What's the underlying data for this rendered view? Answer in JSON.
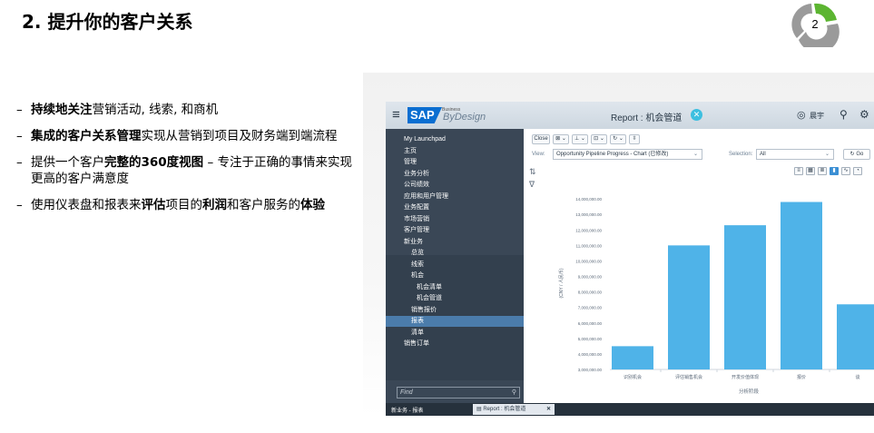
{
  "slide": {
    "title": "2. 提升你的客户关系",
    "step_number": "2",
    "bullets": [
      [
        {
          "t": "持续地关注",
          "b": true
        },
        {
          "t": "营销活动, 线索, 和商机",
          "b": false
        }
      ],
      [
        {
          "t": "集成的客户关系管理",
          "b": true
        },
        {
          "t": "实现从营销到项目及财务端到端流程",
          "b": false
        }
      ],
      [
        {
          "t": "提供一个客户",
          "b": false
        },
        {
          "t": "完整的360度视图",
          "b": true
        },
        {
          "t": " – 专注于正确的事情来实现更高的客户满意度",
          "b": false
        }
      ],
      [
        {
          "t": "使用仪表盘和报表来",
          "b": false
        },
        {
          "t": "评估",
          "b": true
        },
        {
          "t": "项目的",
          "b": false
        },
        {
          "t": "利润",
          "b": true
        },
        {
          "t": "和客户服务的",
          "b": false
        },
        {
          "t": "体验",
          "b": true
        }
      ]
    ],
    "colors": {
      "badge_green": "#5cb531",
      "badge_gray": "#9a9a9a"
    }
  },
  "app": {
    "logo_text": "SAP",
    "logo_super": "Business",
    "logo_name": "ByDesign",
    "report_title": "Report : 机会管道",
    "user_name": "晨宇",
    "icons": {
      "menu": "hamburger-icon",
      "close": "close-icon",
      "user": "user-icon",
      "search": "search-icon",
      "settings": "gear-icon"
    },
    "sidebar": {
      "items": [
        {
          "label": "My Launchpad",
          "level": 1
        },
        {
          "label": "主页",
          "level": 1
        },
        {
          "label": "管理",
          "level": 1
        },
        {
          "label": "业务分析",
          "level": 1
        },
        {
          "label": "公司绩效",
          "level": 1
        },
        {
          "label": "应用和用户管理",
          "level": 1
        },
        {
          "label": "业务配置",
          "level": 1
        },
        {
          "label": "市场营销",
          "level": 1
        },
        {
          "label": "客户管理",
          "level": 1
        },
        {
          "label": "新业务",
          "level": 1
        },
        {
          "label": "总览",
          "level": 2
        },
        {
          "label": "线索",
          "level": 2
        },
        {
          "label": "机会",
          "level": 2
        },
        {
          "label": "机会清单",
          "level": 3
        },
        {
          "label": "机会管道",
          "level": 3
        },
        {
          "label": "销售报价",
          "level": 2
        },
        {
          "label": "报表",
          "level": 2,
          "active": true
        },
        {
          "label": "清单",
          "level": 2
        },
        {
          "label": "销售订单",
          "level": 1
        }
      ],
      "find_placeholder": "Find"
    },
    "toolbar": {
      "close_label": "Close",
      "btn2": "⊠ ⌄",
      "btn3": "⊥ ⌄",
      "btn4": "⊡ ⌄",
      "btn5": "↻ ⌄",
      "btn6": "⇳"
    },
    "view": {
      "label": "View:",
      "value": "Opportunity Pipeline Progress - Chart (已修改)",
      "selection_label": "Selection:",
      "selection_value": "All",
      "go_label": "Go"
    },
    "chart_data": {
      "type": "bar",
      "categories": [
        "识别机会",
        "评估销售机会",
        "开发价值体现",
        "报价",
        "谈"
      ],
      "values": [
        4500000,
        11000000,
        12300000,
        13800000,
        7200000
      ],
      "ylabel": "(CNY / 人民币)",
      "xlabel": "分析阶段",
      "ylim": [
        3000000,
        15000000
      ],
      "y_ticks": [
        "14,000,000.00",
        "13,000,000.00",
        "12,000,000.00",
        "11,000,000.00",
        "10,000,000.00",
        "9,000,000.00",
        "8,000,000.00",
        "7,000,000.00",
        "6,000,000.00",
        "5,000,000.00",
        "4,000,000.00",
        "3,000,000.00"
      ],
      "y_tick_values": [
        14000000,
        13000000,
        12000000,
        11000000,
        10000000,
        9000000,
        8000000,
        7000000,
        6000000,
        5000000,
        4000000,
        3000000
      ],
      "grid": false,
      "bar_color": "#4fb3e8"
    },
    "status": {
      "breadcrumb": "新业务 - 报表",
      "tab_label": "Report : 机会管道"
    }
  }
}
